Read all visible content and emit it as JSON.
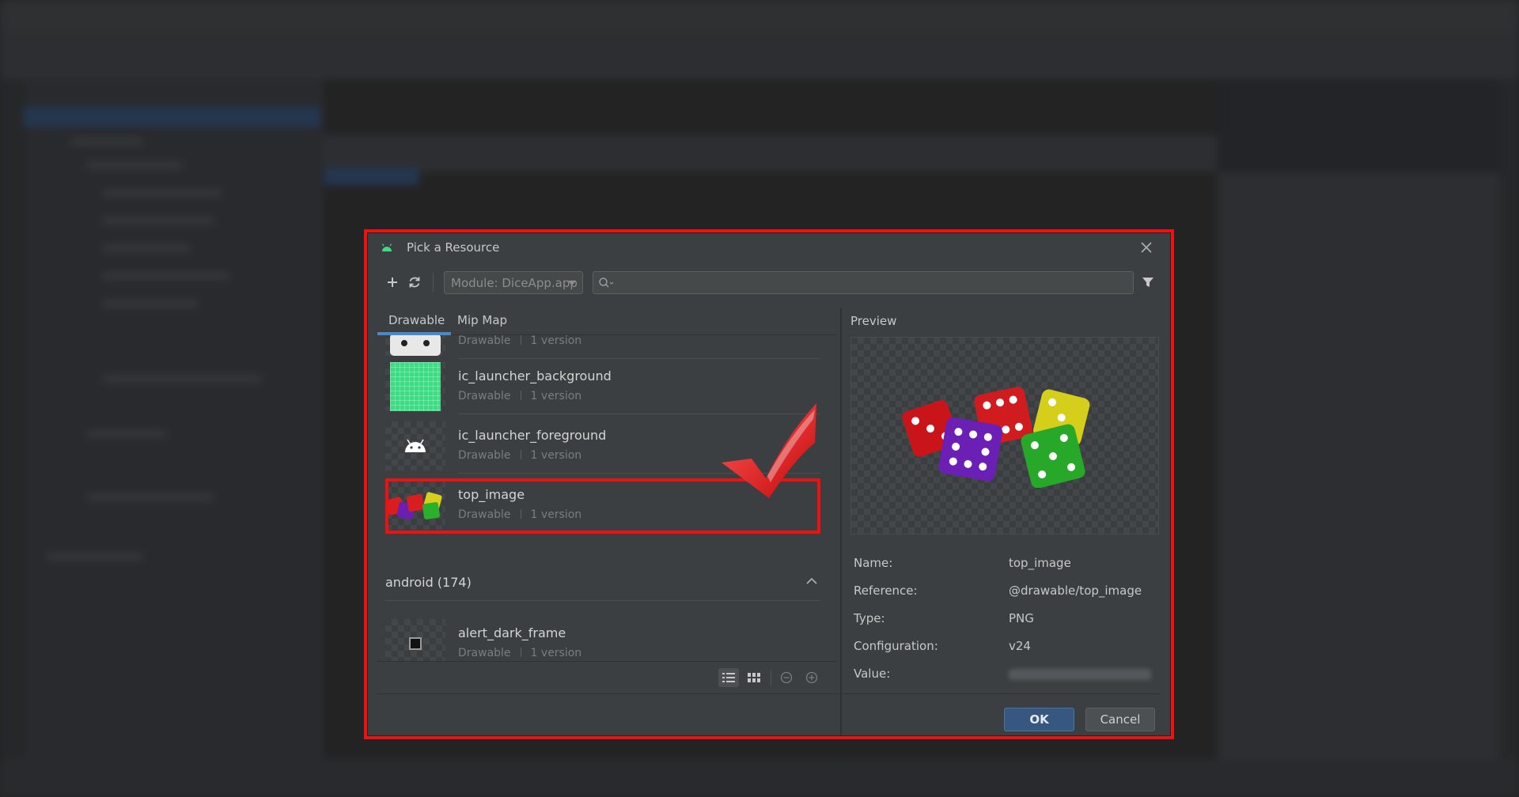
{
  "dialog": {
    "title": "Pick a Resource",
    "module_select": "Module: DiceApp.app",
    "search_placeholder": "",
    "tabs": [
      {
        "label": "Drawable"
      },
      {
        "label": "Mip Map"
      }
    ],
    "resources": [
      {
        "name": "",
        "kind": "Drawable",
        "versions": "1 version"
      },
      {
        "name": "ic_launcher_background",
        "kind": "Drawable",
        "versions": "1 version"
      },
      {
        "name": "ic_launcher_foreground",
        "kind": "Drawable",
        "versions": "1 version"
      },
      {
        "name": "top_image",
        "kind": "Drawable",
        "versions": "1 version"
      }
    ],
    "section": {
      "label": "android (174)"
    },
    "android_resources": [
      {
        "name": "alert_dark_frame",
        "kind": "Drawable",
        "versions": "1 version"
      }
    ],
    "preview": {
      "label": "Preview",
      "props": [
        {
          "key": "Name:",
          "value": "top_image"
        },
        {
          "key": "Reference:",
          "value": "@drawable/top_image"
        },
        {
          "key": "Type:",
          "value": "PNG"
        },
        {
          "key": "Configuration:",
          "value": "v24"
        },
        {
          "key": "Value:",
          "value": ""
        }
      ]
    },
    "buttons": {
      "ok": "OK",
      "cancel": "Cancel"
    }
  },
  "colors": {
    "accent": "#4a88c7",
    "highlight": "#ee1111",
    "android_green": "#3ddc84"
  }
}
